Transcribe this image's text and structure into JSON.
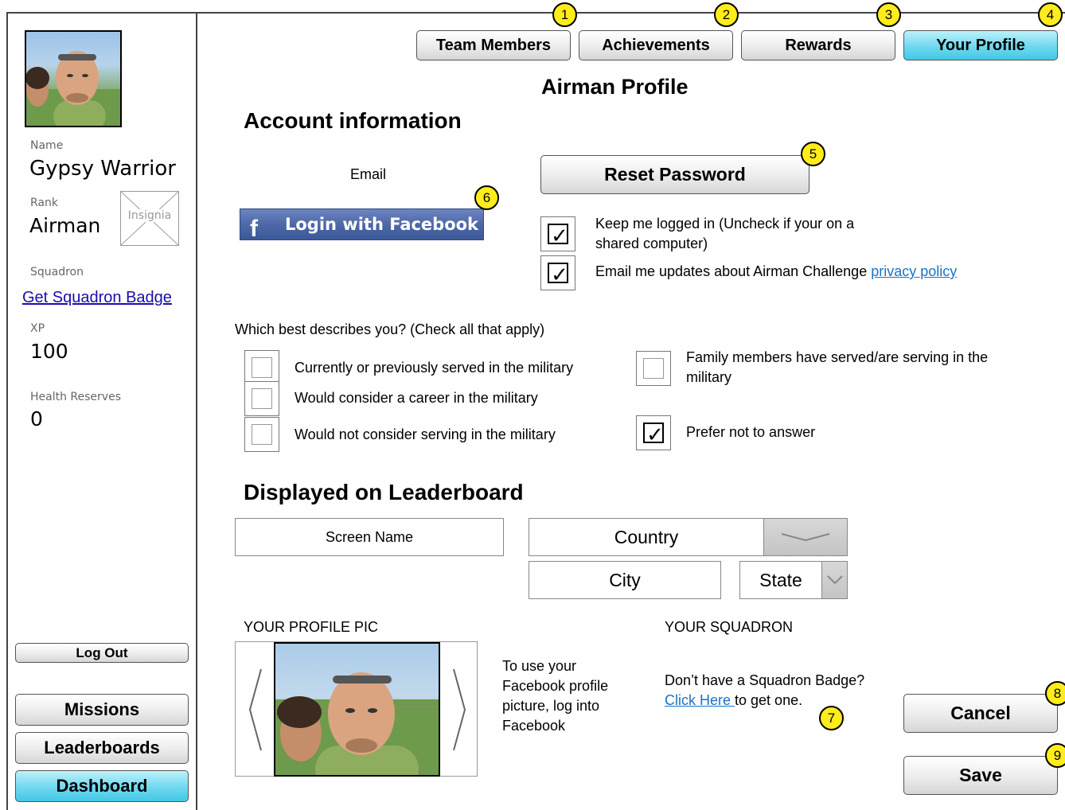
{
  "sidebar": {
    "name_label": "Name",
    "name_value": "Gypsy Warrior",
    "rank_label": "Rank",
    "rank_value": "Airman",
    "insignia_placeholder": "Insignia",
    "squadron_label": "Squadron",
    "squadron_link": "Get Squadron Badge",
    "xp_label": "XP",
    "xp_value": "100",
    "health_label": "Health Reserves",
    "health_value": "0",
    "logout": "Log Out",
    "nav": [
      "Missions",
      "Leaderboards",
      "Dashboard"
    ],
    "active_nav": "Dashboard"
  },
  "tabs": [
    "Team Members",
    "Achievements",
    "Rewards",
    "Your Profile"
  ],
  "active_tab": "Your Profile",
  "badges": [
    "1",
    "2",
    "3",
    "4",
    "5",
    "6",
    "7",
    "8",
    "9"
  ],
  "page_title": "Airman Profile",
  "account": {
    "heading": "Account information",
    "email_label": "Email",
    "facebook_logo": "f",
    "facebook_button": "Login with Facebook",
    "reset_password": "Reset Password",
    "keep_logged_in": "Keep me logged in (Uncheck if your on a shared computer)",
    "keep_logged_in_checked": true,
    "email_updates": "Email me updates about Airman Challenge ",
    "email_updates_checked": true,
    "privacy_link": "privacy policy"
  },
  "survey": {
    "question": "Which best describes you? (Check all that apply)",
    "options": [
      {
        "label": "Currently or previously served in the military",
        "checked": false
      },
      {
        "label": "Would consider a career in the military",
        "checked": false
      },
      {
        "label": "Would not consider serving in the military",
        "checked": false
      },
      {
        "label": "Family members have served/are serving in the military",
        "checked": false
      },
      {
        "label": "Prefer not to answer",
        "checked": true
      }
    ],
    "checkmark": "✓"
  },
  "leaderboard": {
    "heading": "Displayed on Leaderboard",
    "screen_name": "Screen Name",
    "country": "Country",
    "city": "City",
    "state": "State"
  },
  "profile_pic": {
    "label": "YOUR PROFILE PIC",
    "facebook_note": "To use your Facebook profile picture, log into Facebook"
  },
  "squadron": {
    "label": "YOUR SQUADRON",
    "prompt": "Don’t have a Squadron Badge?",
    "link": "Click Here ",
    "link_suffix": "to get one."
  },
  "actions": {
    "cancel": "Cancel",
    "save": "Save"
  },
  "colors": {
    "active_button": "#43c8e6",
    "badge": "#ffec1a",
    "facebook": "#3b5998",
    "link": "#1a73c7"
  }
}
